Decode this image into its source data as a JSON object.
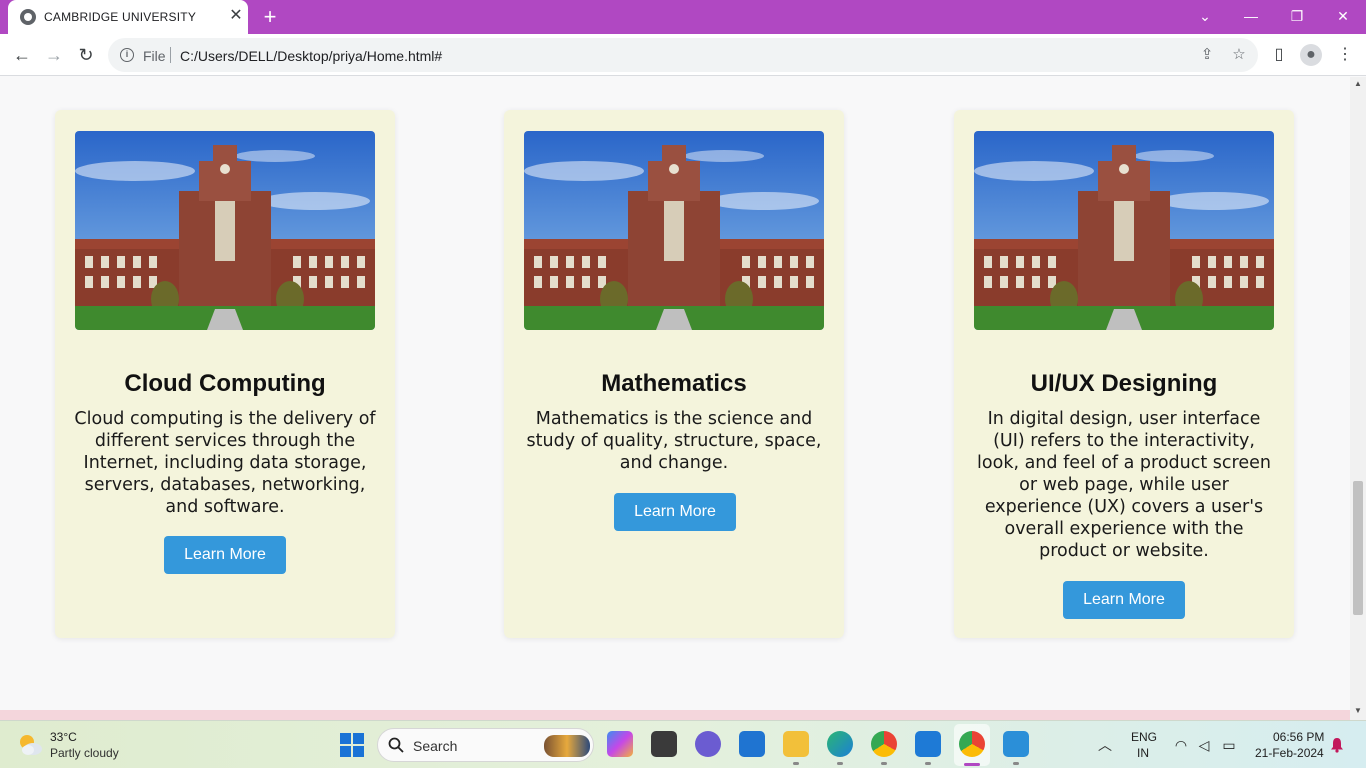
{
  "browser": {
    "tab_title": "CAMBRIDGE UNIVERSITY",
    "url_scheme": "File",
    "url": "C:/Users/DELL/Desktop/priya/Home.html#"
  },
  "courses": [
    {
      "title": "Cloud Computing",
      "description": "Cloud computing is the delivery of different services through the Internet, including data storage, servers, databases, networking, and software.",
      "button": "Learn More"
    },
    {
      "title": "Mathematics",
      "description": "Mathematics is the science and study of quality, structure, space, and change.",
      "button": "Learn More"
    },
    {
      "title": "UI/UX Designing",
      "description": "In digital design, user interface (UI) refers to the interactivity, look, and feel of a product screen or web page, while user experience (UX) covers a user's overall experience with the product or website.",
      "button": "Learn More"
    }
  ],
  "colors": {
    "card_background": "#f4f4dc",
    "button": "#3498db",
    "tab_bar": "#b048c2"
  },
  "taskbar": {
    "weather_temp": "33°C",
    "weather_desc": "Partly cloudy",
    "search_placeholder": "Search",
    "language_line1": "ENG",
    "language_line2": "IN",
    "time": "06:56 PM",
    "date": "21-Feb-2024"
  },
  "icons": [
    "globe-icon",
    "close-icon",
    "plus-icon",
    "back-icon",
    "forward-icon",
    "reload-icon",
    "info-icon",
    "share-icon",
    "star-icon",
    "sidepanel-icon",
    "profile-icon",
    "menu-icon",
    "weather-icon",
    "windows-start-icon",
    "search-icon",
    "wifi-icon",
    "volume-icon",
    "battery-icon",
    "bell-icon"
  ]
}
